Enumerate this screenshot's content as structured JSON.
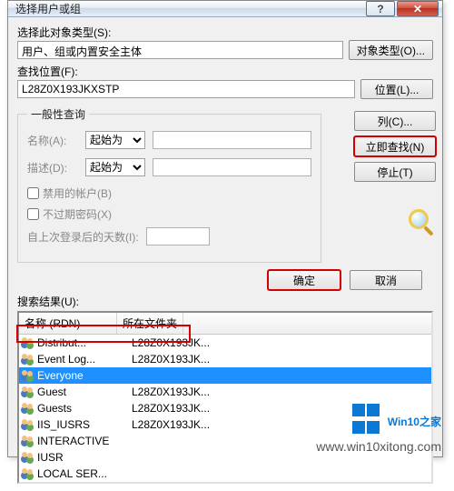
{
  "window": {
    "title": "选择用户或组",
    "help_glyph": "?",
    "close_glyph": "✕"
  },
  "object_type": {
    "label": "选择此对象类型(S):",
    "value": "用户、组或内置安全主体",
    "button": "对象类型(O)..."
  },
  "location": {
    "label": "查找位置(F):",
    "value": "L28Z0X193JKXSTP",
    "button": "位置(L)..."
  },
  "general": {
    "legend": "一般性查询",
    "name_label": "名称(A):",
    "name_mode": "起始为",
    "desc_label": "描述(D):",
    "desc_mode": "起始为",
    "chk_disabled": "禁用的帐户(B)",
    "chk_noexpire": "不过期密码(X)",
    "lastlogin_label": "自上次登录后的天数(I):"
  },
  "right_buttons": {
    "columns": "列(C)...",
    "find_now": "立即查找(N)",
    "stop": "停止(T)"
  },
  "footer": {
    "ok": "确定",
    "cancel": "取消"
  },
  "results": {
    "label": "搜索结果(U):",
    "col_name": "名称 (RDN)",
    "col_folder": "所在文件夹",
    "rows": [
      {
        "name": "Distribut...",
        "folder": "L28Z0X193JK..."
      },
      {
        "name": "Event Log...",
        "folder": "L28Z0X193JK..."
      },
      {
        "name": "Everyone",
        "folder": ""
      },
      {
        "name": "Guest",
        "folder": "L28Z0X193JK..."
      },
      {
        "name": "Guests",
        "folder": "L28Z0X193JK..."
      },
      {
        "name": "IIS_IUSRS",
        "folder": "L28Z0X193JK..."
      },
      {
        "name": "INTERACTIVE",
        "folder": ""
      },
      {
        "name": "IUSR",
        "folder": ""
      },
      {
        "name": "LOCAL SER...",
        "folder": ""
      }
    ]
  },
  "watermark": {
    "brand_part1": "Win10",
    "brand_part2": "之家",
    "url": "www.win10xitong.com"
  }
}
